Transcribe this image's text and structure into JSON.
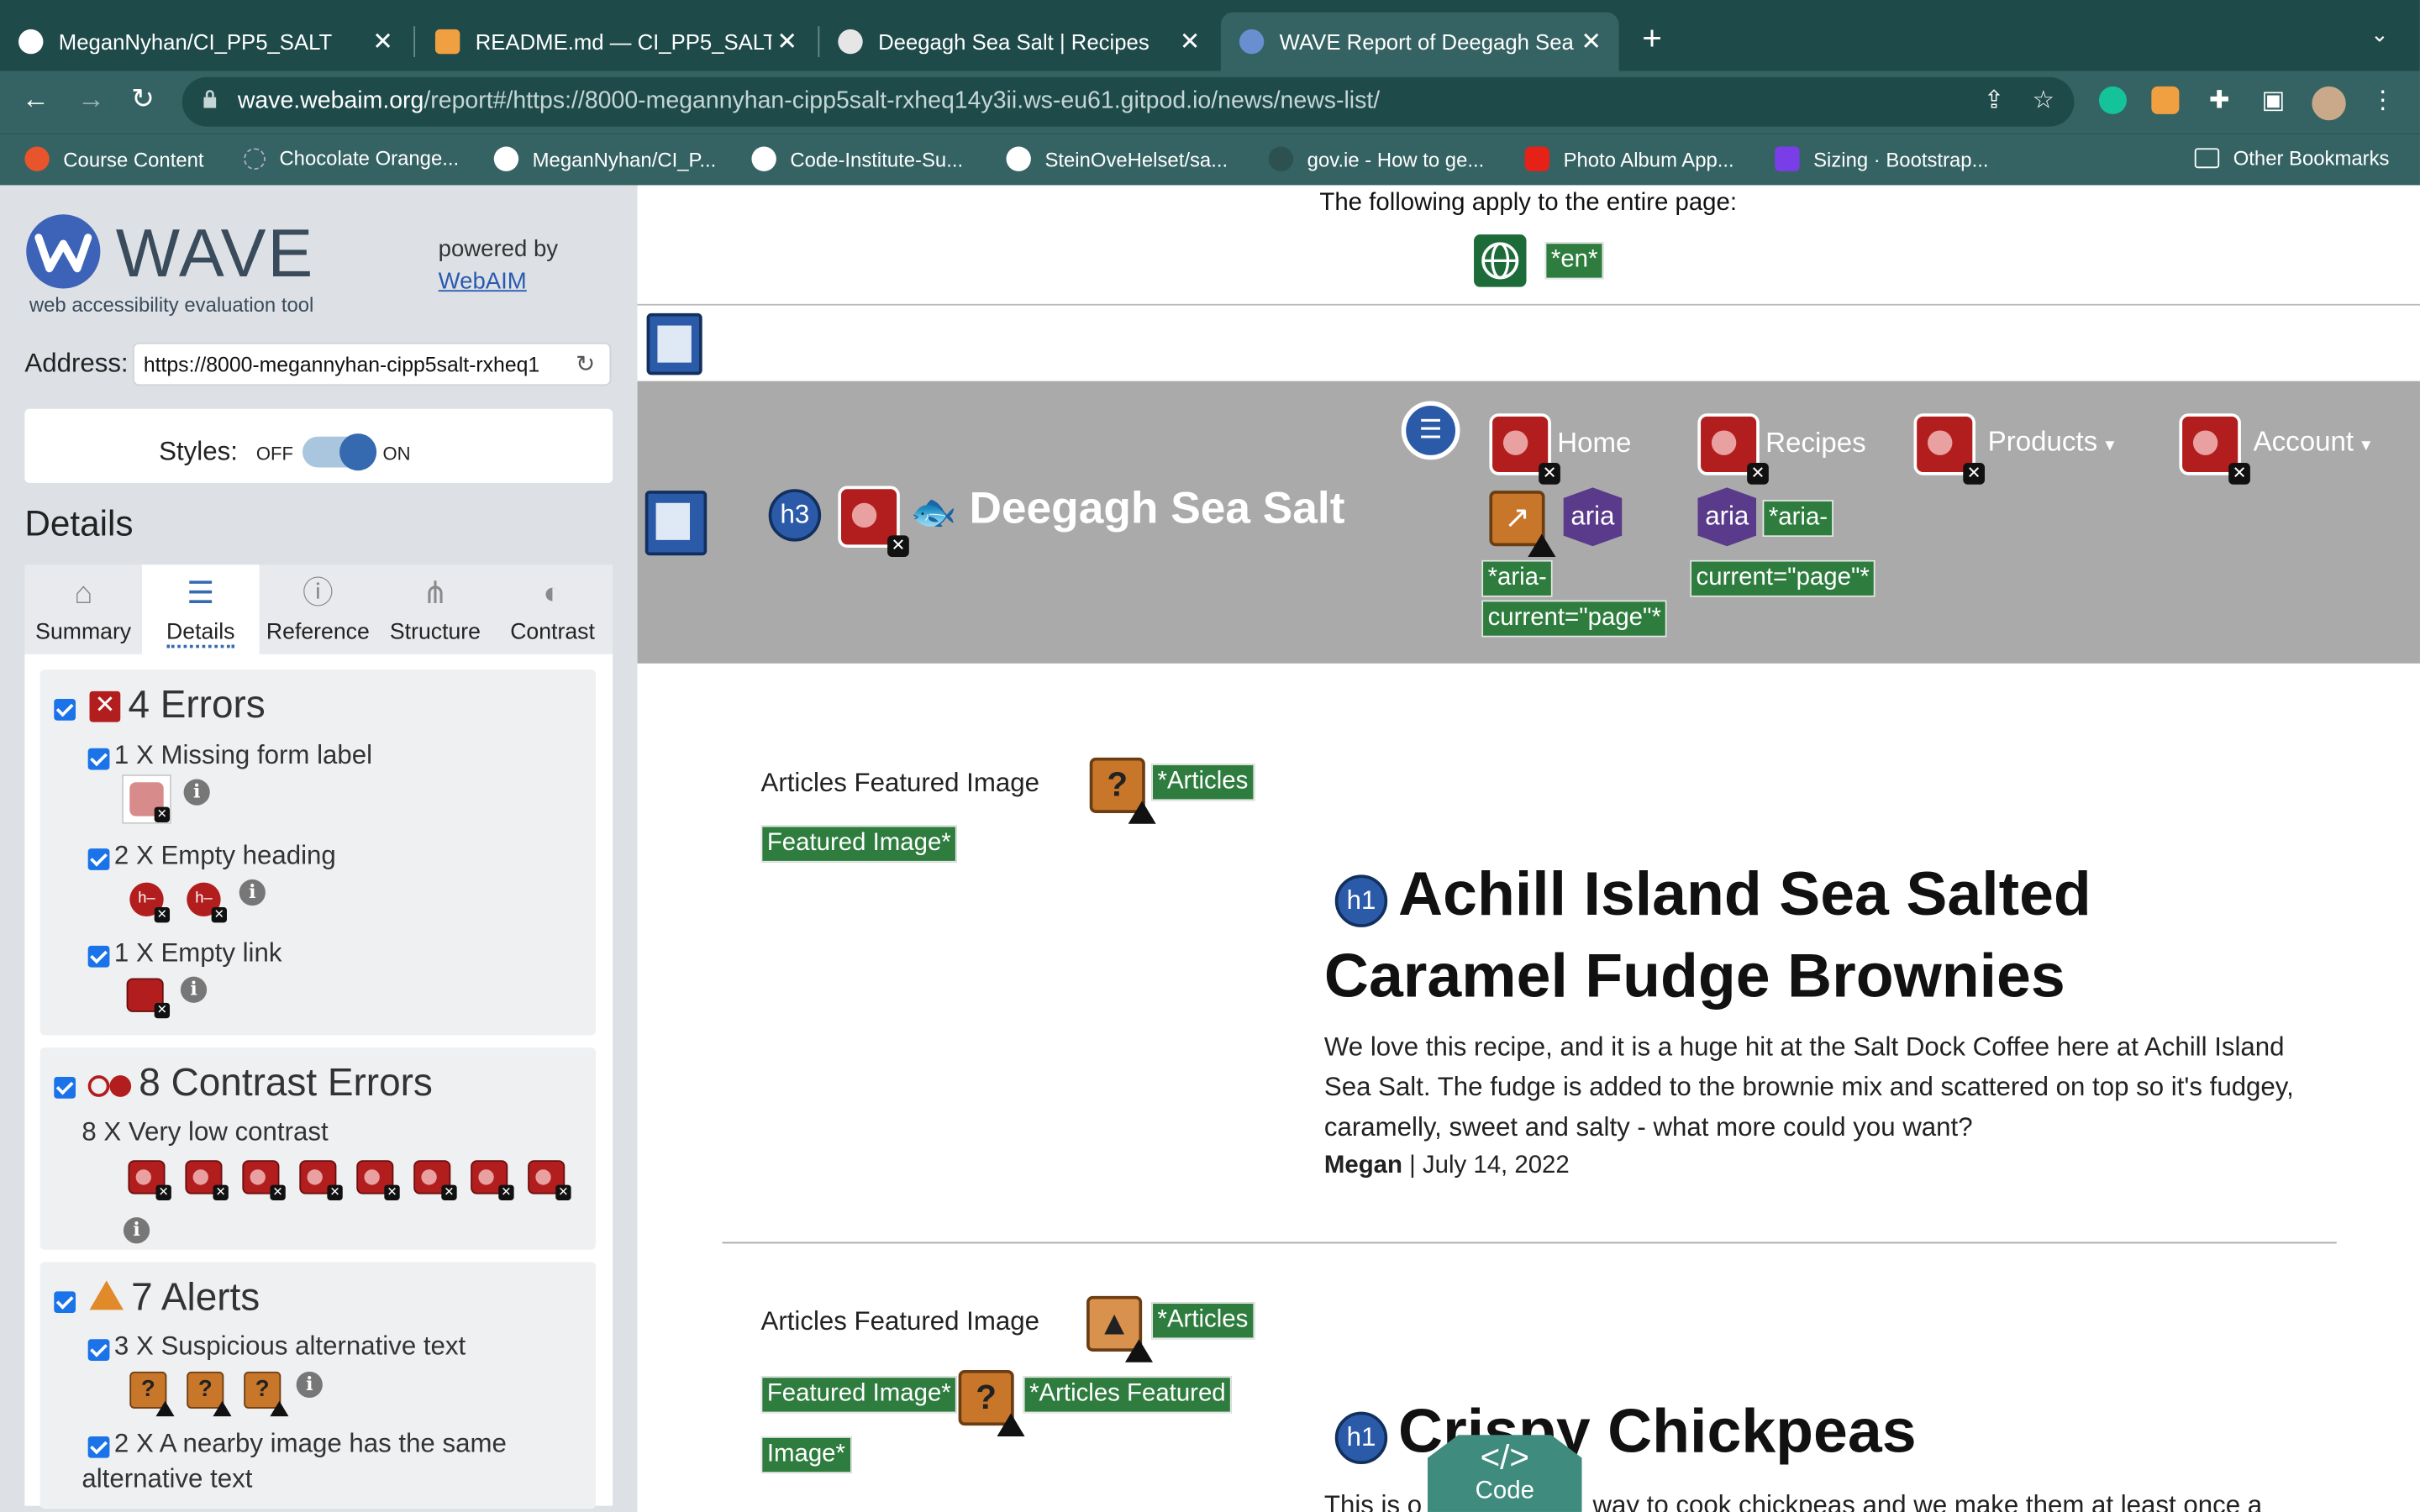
{
  "browser": {
    "tabs": [
      {
        "title": "MeganNyhan/CI_PP5_SALT",
        "close": "✕"
      },
      {
        "title": "README.md — CI_PP5_SALT — ",
        "close": "✕"
      },
      {
        "title": "Deegagh Sea Salt | Recipes",
        "close": "✕"
      },
      {
        "title": "WAVE Report of Deegagh Sea ",
        "close": "✕"
      }
    ],
    "new_tab": "+",
    "url_host": "wave.webaim.org",
    "url_rest": "/report#/https://8000-megannyhan-cipp5salt-rxheq14y3ii.ws-eu61.gitpod.io/news/news-list/",
    "bookmarks": [
      "Course Content",
      "Chocolate Orange...",
      "MeganNyhan/CI_P...",
      "Code-Institute-Su...",
      "SteinOveHelset/sa...",
      "gov.ie - How to ge...",
      "Photo Album App...",
      "Sizing · Bootstrap...",
      "Other Bookmarks"
    ]
  },
  "wave": {
    "title": "WAVE",
    "subtitle": "web accessibility evaluation tool",
    "powered_by": "powered by",
    "webaim": "WebAIM",
    "address_label": "Address:",
    "address_value": "https://8000-megannyhan-cipp5salt-rxheq1",
    "styles_label": "Styles:",
    "off": "OFF",
    "on": "ON",
    "details_heading": "Details",
    "tabs": [
      "Summary",
      "Details",
      "Reference",
      "Structure",
      "Contrast"
    ],
    "errors": {
      "heading": "4 Errors",
      "items": [
        "1 X Missing form label",
        "2 X Empty heading",
        "1 X Empty link"
      ]
    },
    "contrast": {
      "heading": "8 Contrast Errors",
      "item": "8 X Very low contrast"
    },
    "alerts": {
      "heading": "7 Alerts",
      "items": [
        "3 X Suspicious alternative text",
        "2 X A nearby image has the same",
        "alternative text"
      ]
    }
  },
  "page": {
    "apply_text": "The following apply to the entire page:",
    "lang_tag": "*en*",
    "brand": "Deegagh Sea Salt",
    "nav": [
      "Home",
      "Recipes",
      "Products",
      "Account"
    ],
    "aria": "aria",
    "aria_current_home_1": "*aria-",
    "aria_current_home_2": "current=\"page\"*",
    "aria_current_rec_1": "*aria-",
    "aria_current_rec_2": "current=\"page\"*",
    "h3": "h3",
    "h1": "h1",
    "articles": [
      {
        "img_alt": "Articles Featured Image",
        "tag1": "*Articles",
        "tag2": "Featured Image*",
        "title_line1": "Achill Island Sea Salted",
        "title_line2": "Caramel Fudge Brownies",
        "excerpt": "We love this recipe, and it is a huge hit at the Salt Dock Coffee here at Achill Island Sea Salt. The fudge is added to the brownie mix and scattered on top so it's fudgey, caramelly, sweet and salty - what more could you want?",
        "author": "Megan",
        "date": " | July 14, 2022"
      },
      {
        "img_alt": "Articles Featured Image",
        "tag1": "*Articles",
        "tag2": "Featured Image*",
        "tag3": "*Articles Featured",
        "tag4": "Image*",
        "title": "Crispy Chickpeas",
        "excerpt_start": "This is o",
        "excerpt_end": "way to cook chickpeas and we make them at least once a"
      }
    ],
    "code_label": "Code",
    "code_symbol": "</>"
  }
}
